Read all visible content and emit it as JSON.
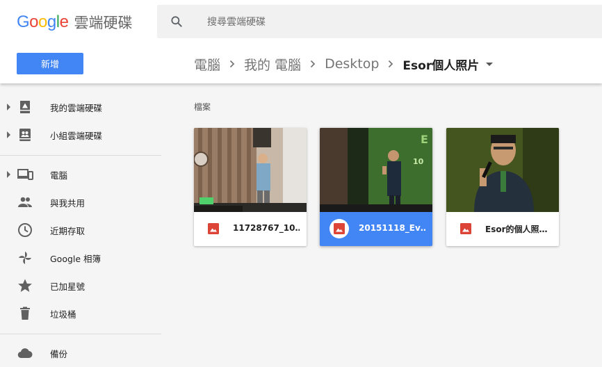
{
  "header": {
    "logo_text": "Google",
    "product_name": "雲端硬碟",
    "search_placeholder": "搜尋雲端硬碟",
    "new_button_label": "新增"
  },
  "breadcrumb": {
    "items": [
      "電腦",
      "我的 電腦",
      "Desktop"
    ],
    "current": "Esor個人照片"
  },
  "sidebar": {
    "items": [
      {
        "label": "我的雲端硬碟",
        "icon": "my-drive-icon"
      },
      {
        "label": "小組雲端硬碟",
        "icon": "team-drive-icon"
      },
      {
        "label": "電腦",
        "icon": "computers-icon"
      },
      {
        "label": "與我共用",
        "icon": "shared-with-me-icon"
      },
      {
        "label": "近期存取",
        "icon": "recent-icon"
      },
      {
        "label": "Google 相簿",
        "icon": "google-photos-icon"
      },
      {
        "label": "已加星號",
        "icon": "star-icon"
      },
      {
        "label": "垃圾桶",
        "icon": "trash-icon"
      },
      {
        "label": "備份",
        "icon": "backup-cloud-icon"
      }
    ]
  },
  "main": {
    "section_title": "檔案",
    "files": [
      {
        "name": "11728767_10…",
        "type": "image",
        "selected": false
      },
      {
        "name": "20151118_Ev…",
        "type": "image",
        "selected": true
      },
      {
        "name": "Esor的個人照…",
        "type": "image",
        "selected": false
      }
    ]
  },
  "colors": {
    "accent": "#4285f4",
    "image_file_icon": "#db4437",
    "google_blue": "#4285f4",
    "google_red": "#ea4335",
    "google_yellow": "#fbbc05",
    "google_green": "#34a853"
  }
}
